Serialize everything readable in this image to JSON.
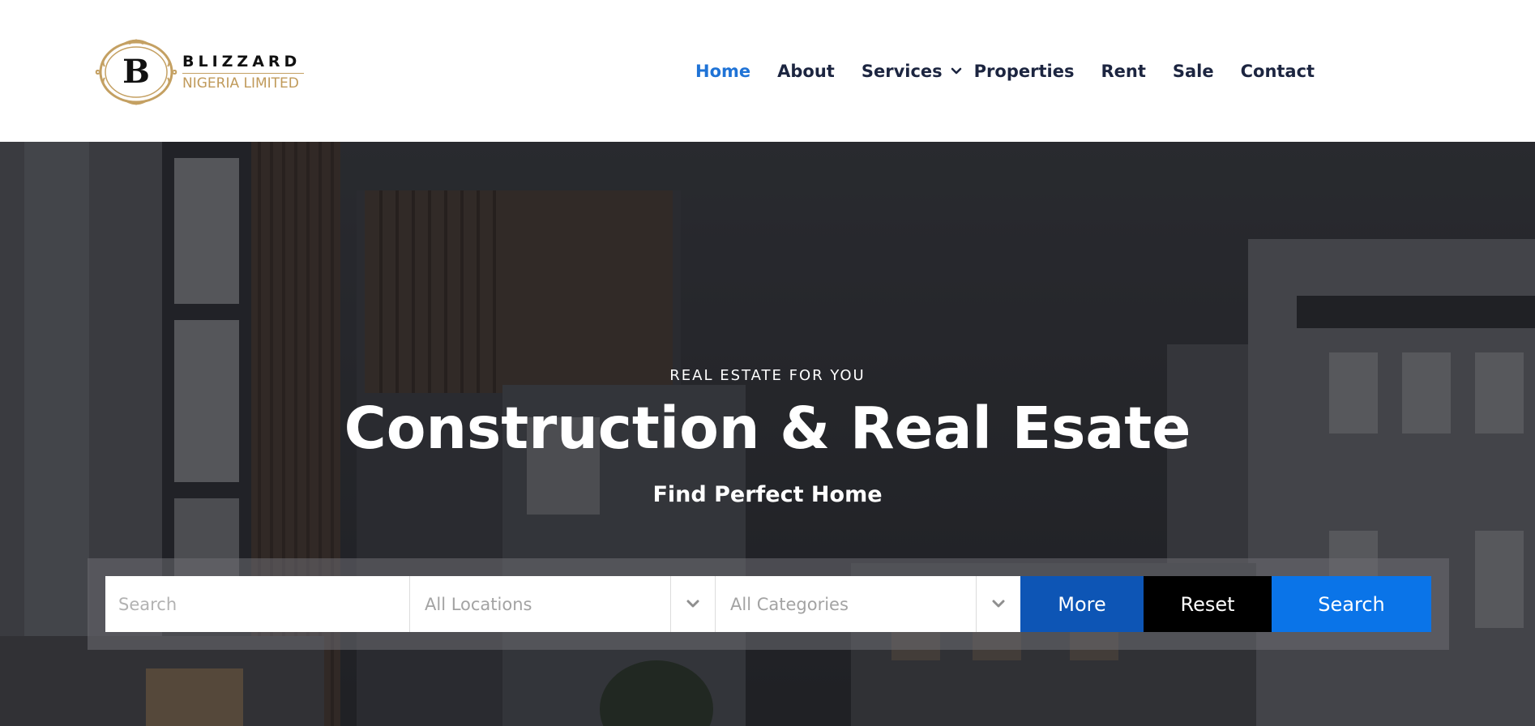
{
  "brand": {
    "emblem_letter": "B",
    "name_top": "BLIZZARD",
    "name_bottom": "NIGERIA LIMITED",
    "gold_color": "#c09a5a"
  },
  "nav": {
    "items": [
      {
        "label": "Home",
        "active": true
      },
      {
        "label": "About",
        "active": false
      },
      {
        "label": "Services",
        "active": false,
        "dropdown_icon": "chevron-down-icon"
      },
      {
        "label": "Properties",
        "active": false
      },
      {
        "label": "Rent",
        "active": false
      },
      {
        "label": "Sale",
        "active": false
      },
      {
        "label": "Contact",
        "active": false
      }
    ],
    "active_color": "#1f73d6",
    "text_color": "#1c2540"
  },
  "hero": {
    "kicker": "REAL ESTATE FOR YOU",
    "title": "Construction & Real Esate",
    "subtitle": "Find Perfect Home"
  },
  "search_bar": {
    "search_placeholder": "Search",
    "location_select": {
      "selected": "All Locations",
      "icon": "chevron-down-icon"
    },
    "category_select": {
      "selected": "All Categories",
      "icon": "chevron-down-icon"
    },
    "more_label": "More",
    "reset_label": "Reset",
    "search_label": "Search",
    "colors": {
      "more": "#0d55b5",
      "reset": "#000000",
      "search": "#0a74e8"
    }
  }
}
